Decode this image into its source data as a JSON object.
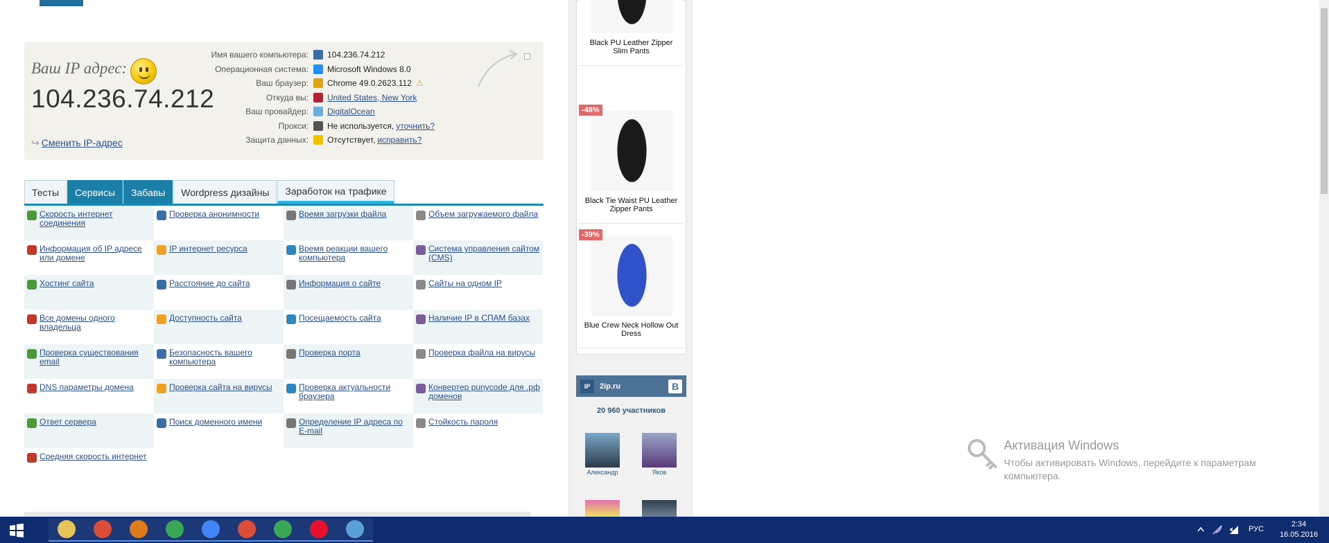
{
  "ipbox": {
    "label": "Ваш IP адрес:",
    "ip": "104.236.74.212",
    "change_link": "Сменить IP-адрес",
    "info": [
      {
        "label": "Имя вашего компьютера:",
        "value": "104.236.74.212",
        "link": false,
        "icon": "computer-icon",
        "color": "#3a6ea8"
      },
      {
        "label": "Операционная система:",
        "value": "Microsoft Windows 8.0",
        "link": false,
        "icon": "windows-icon",
        "color": "#1e90ff"
      },
      {
        "label": "Ваш браузер:",
        "value": "Chrome 49.0.2623.112",
        "link": false,
        "icon": "chrome-icon",
        "color": "#e2a21b",
        "warn": true
      },
      {
        "label": "Откуда вы:",
        "value": "United States, New York",
        "link": true,
        "icon": "us-flag-icon",
        "color": "#b22234"
      },
      {
        "label": "Ваш провайдер:",
        "value": "DigitalOcean",
        "link": true,
        "icon": "cloud-icon",
        "color": "#6ab0de"
      },
      {
        "label": "Прокси:",
        "value": "Не используется,",
        "extra": "уточнить?",
        "link": false,
        "icon": "glasses-icon",
        "color": "#555"
      },
      {
        "label": "Защита данных:",
        "value": "Отсутствует,",
        "extra": "исправить?",
        "link": false,
        "icon": "warning-icon",
        "color": "#f2c200"
      }
    ]
  },
  "tabs": [
    "Тесты",
    "Сервисы",
    "Забавы",
    "Wordpress дизайны",
    "Заработок на трафике"
  ],
  "grid": [
    [
      "Скорость интернет соединения",
      "Проверка анонимности",
      "Время загрузки файла",
      "Объем загружаемого файла"
    ],
    [
      "Информация об IP адресе или домене",
      "IP интернет ресурса",
      "Время реакции вашего компьютера",
      "Система управления сайтом (CMS)"
    ],
    [
      "Хостинг сайта",
      "Расстояние до сайта",
      "Информация о сайте",
      "Сайты на одном IP"
    ],
    [
      "Все домены одного владельца",
      "Доступность сайта",
      "Посещаемость сайта",
      "Наличие IP в СПАМ базах"
    ],
    [
      "Проверка существования email",
      "Безопасность вашего компьютера",
      "Проверка порта",
      "Проверка файла на вирусы"
    ],
    [
      "DNS параметры домена",
      "Проверка сайта на вирусы",
      "Проверка актуальности браузера",
      "Конвертер punycode для .рф доменов"
    ],
    [
      "Ответ сервера",
      "Поиск доменного имени",
      "Определение IP адреса по E-mail",
      "Стойкость пароля"
    ],
    [
      "Средняя скорость интернет",
      "",
      "",
      ""
    ]
  ],
  "products": [
    {
      "name": "Black PU Leather Zipper Slim Pants",
      "discount": ""
    },
    {
      "name": "Black Tie Waist PU Leather Zipper Pants",
      "discount": "-48%"
    },
    {
      "name": "Blue Crew Neck Hollow Out Dress",
      "discount": "-39%"
    }
  ],
  "vk": {
    "name": "2ip.ru",
    "logo": "IP",
    "members": "20 960 участников",
    "users": [
      "Александр",
      "Яков"
    ]
  },
  "activation": {
    "title": "Активация Windows",
    "text": "Чтобы активировать Windows, перейдите к параметрам компьютера."
  },
  "taskbar": {
    "lang": "РУС",
    "time": "2:34",
    "date": "16.05.2016"
  }
}
